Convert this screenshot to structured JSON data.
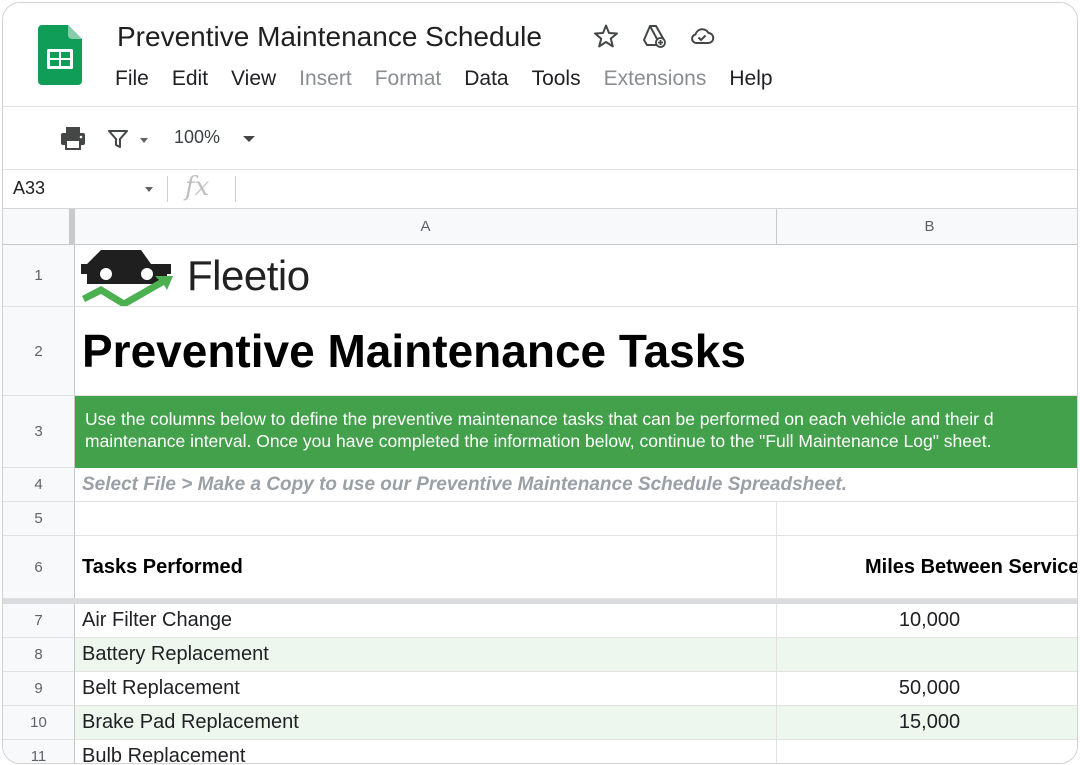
{
  "app": {
    "title": "Preventive Maintenance Schedule",
    "menus": [
      {
        "label": "File",
        "enabled": true
      },
      {
        "label": "Edit",
        "enabled": true
      },
      {
        "label": "View",
        "enabled": true
      },
      {
        "label": "Insert",
        "enabled": false
      },
      {
        "label": "Format",
        "enabled": false
      },
      {
        "label": "Data",
        "enabled": true
      },
      {
        "label": "Tools",
        "enabled": true
      },
      {
        "label": "Extensions",
        "enabled": false
      },
      {
        "label": "Help",
        "enabled": true
      }
    ],
    "title_icons": [
      "star-icon",
      "drive-add-icon",
      "cloud-saved-icon"
    ],
    "accent_color": "#0f9d58"
  },
  "toolbar": {
    "zoom": "100%",
    "icons": [
      "print-icon",
      "filter-icon",
      "chevron-down-icon"
    ]
  },
  "formula_bar": {
    "cell_ref": "A33",
    "fx_label": "fx",
    "value": ""
  },
  "sheet": {
    "columns": [
      "A",
      "B"
    ],
    "brand": "Fleetio",
    "heading": "Preventive Maintenance Tasks",
    "instructions_line1": "Use the columns below to define the preventive maintenance tasks that can be performed on each vehicle and their d",
    "instructions_line2": "maintenance interval. Once you have completed the information below, continue to the \"Full Maintenance Log\" sheet.",
    "copy_note": "Select File > Make a Copy to use our Preventive Maintenance Schedule Spreadsheet.",
    "header_task": "Tasks Performed",
    "header_miles": "Miles Between Service",
    "banner_color": "#43a04b",
    "band_color": "#edf7ee",
    "rows": [
      {
        "num": "1"
      },
      {
        "num": "2"
      },
      {
        "num": "3"
      },
      {
        "num": "4"
      },
      {
        "num": "5"
      },
      {
        "num": "6"
      },
      {
        "num": "7",
        "task": "Air Filter Change",
        "miles": "10,000"
      },
      {
        "num": "8",
        "task": "Battery Replacement",
        "miles": ""
      },
      {
        "num": "9",
        "task": "Belt Replacement",
        "miles": "50,000"
      },
      {
        "num": "10",
        "task": "Brake Pad Replacement",
        "miles": "15,000"
      },
      {
        "num": "11",
        "task": "Bulb Replacement",
        "miles": ""
      }
    ]
  }
}
